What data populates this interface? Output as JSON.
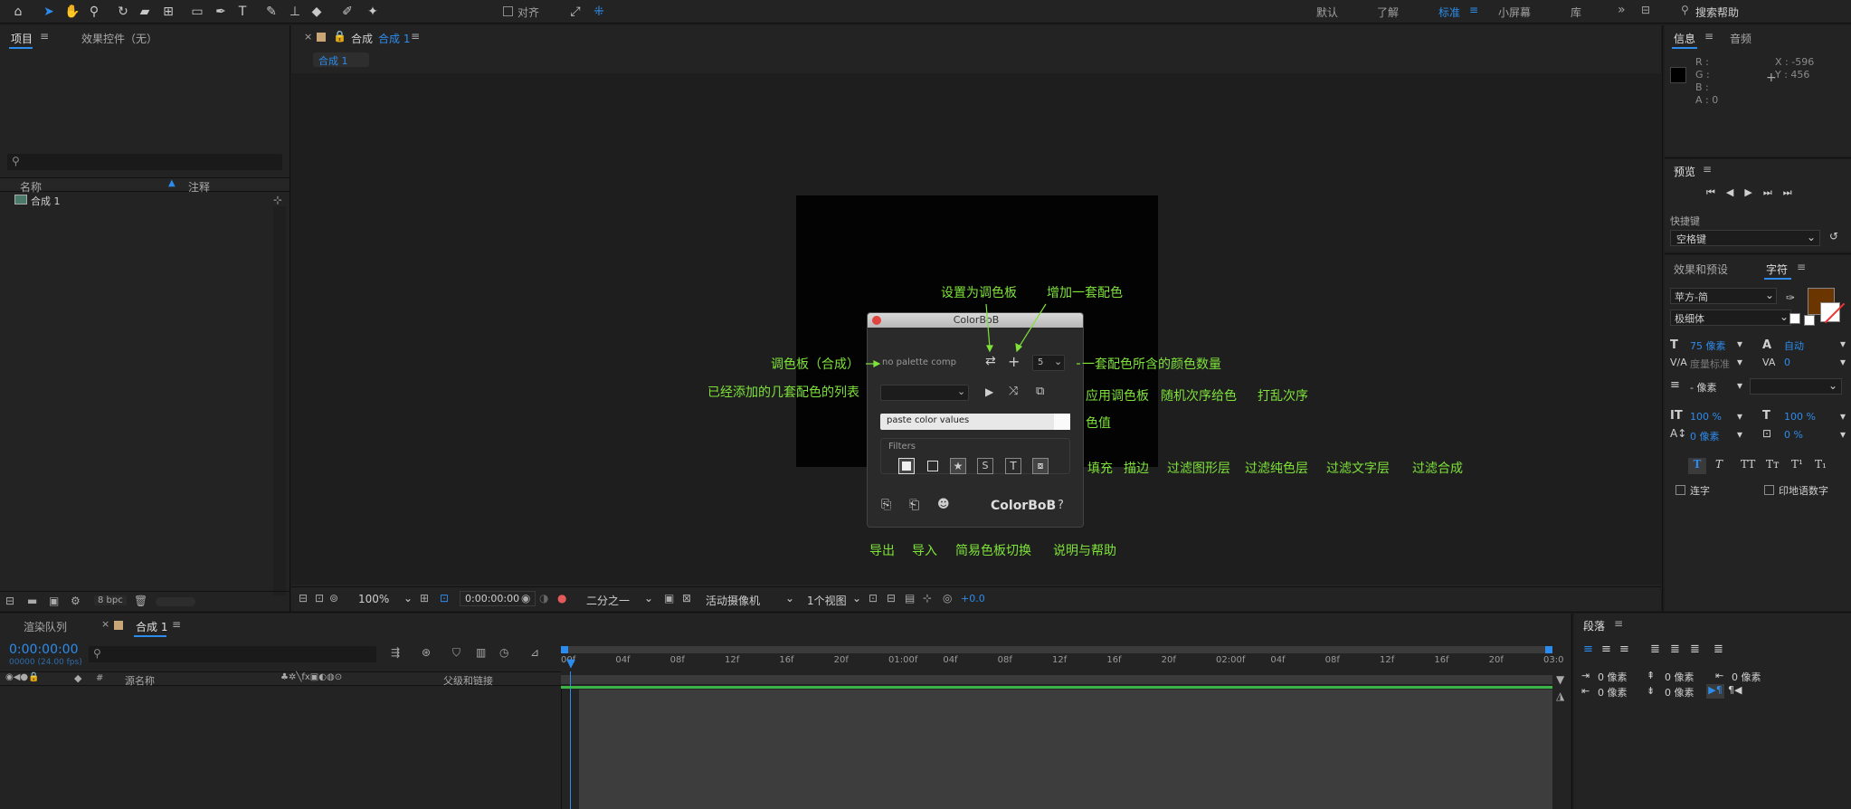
{
  "toolbar": {
    "align_label": "对齐",
    "workspaces": [
      "默认",
      "了解",
      "标准",
      "小屏幕",
      "库"
    ],
    "search_placeholder": "搜索帮助"
  },
  "project_panel": {
    "tab_project": "项目",
    "tab_effects": "效果控件（无）",
    "col_name": "名称",
    "col_comment": "注释",
    "item_name": "合成 1",
    "bpc": "8 bpc"
  },
  "comp_panel": {
    "tab_title": "合成",
    "tab_comp": "合成 1",
    "breadcrumb": "合成 1",
    "zoom": "100%",
    "timecode": "0:00:00:00",
    "resolution": "二分之一",
    "camera": "活动摄像机",
    "views": "1个视图",
    "exposure": "+0.0"
  },
  "colorbob": {
    "title": "ColorBoB",
    "palette_text": "no palette comp",
    "count": "5",
    "paste_placeholder": "paste color values",
    "filters_label": "Filters",
    "logo": "ColorBoB",
    "help": "?"
  },
  "annotations": {
    "set_palette": "设置为调色板",
    "add_set": "增加一套配色",
    "palette_comp": "调色板（合成）",
    "count_desc": "一套配色所含的颜色数量",
    "list_desc": "已经添加的几套配色的列表",
    "apply": "应用调色板",
    "random": "随机次序给色",
    "shuffle": "打乱次序",
    "color_values": "色值",
    "fill": "填充",
    "stroke": "描边",
    "filter_shape": "过滤图形层",
    "filter_solid": "过滤纯色层",
    "filter_text": "过滤文字层",
    "filter_comp": "过滤合成",
    "export": "导出",
    "import": "导入",
    "simple_switch": "简易色板切换",
    "help": "说明与帮助"
  },
  "info_panel": {
    "tab_info": "信息",
    "tab_audio": "音频",
    "r": "R :",
    "g": "G :",
    "b": "B :",
    "a": "A : 0",
    "x": "X : -596",
    "y": "Y : 456"
  },
  "preview_panel": {
    "title": "预览",
    "shortcut_label": "快捷键",
    "shortcut_value": "空格键"
  },
  "char_panel": {
    "tab_effects": "效果和预设",
    "tab_char": "字符",
    "font": "苹方-简",
    "weight": "极细体",
    "size": "75 像素",
    "leading": "自动",
    "kerning": "度量标准",
    "tracking": "0",
    "stroke_width": "- 像素",
    "vscale": "100 %",
    "hscale": "100 %",
    "baseline": "0 像素",
    "tsume": "0 %",
    "ligature": "连字",
    "hindi": "印地语数字",
    "fill_color": "#6b3500"
  },
  "para_panel": {
    "title": "段落",
    "v1": "0 像素",
    "v2": "0 像素",
    "v3": "0 像素",
    "v4": "0 像素",
    "v5": "0 像素"
  },
  "timeline": {
    "tab_render": "渲染队列",
    "tab_comp": "合成 1",
    "timecode": "0:00:00:00",
    "frames": "00000 (24.00 fps)",
    "col_source": "源名称",
    "col_parent": "父级和链接",
    "col_hash": "#",
    "ticks": [
      "00f",
      "04f",
      "08f",
      "12f",
      "16f",
      "20f",
      "01:00f",
      "04f",
      "08f",
      "12f",
      "16f",
      "20f",
      "02:00f",
      "04f",
      "08f",
      "12f",
      "16f",
      "20f",
      "03:0"
    ]
  }
}
